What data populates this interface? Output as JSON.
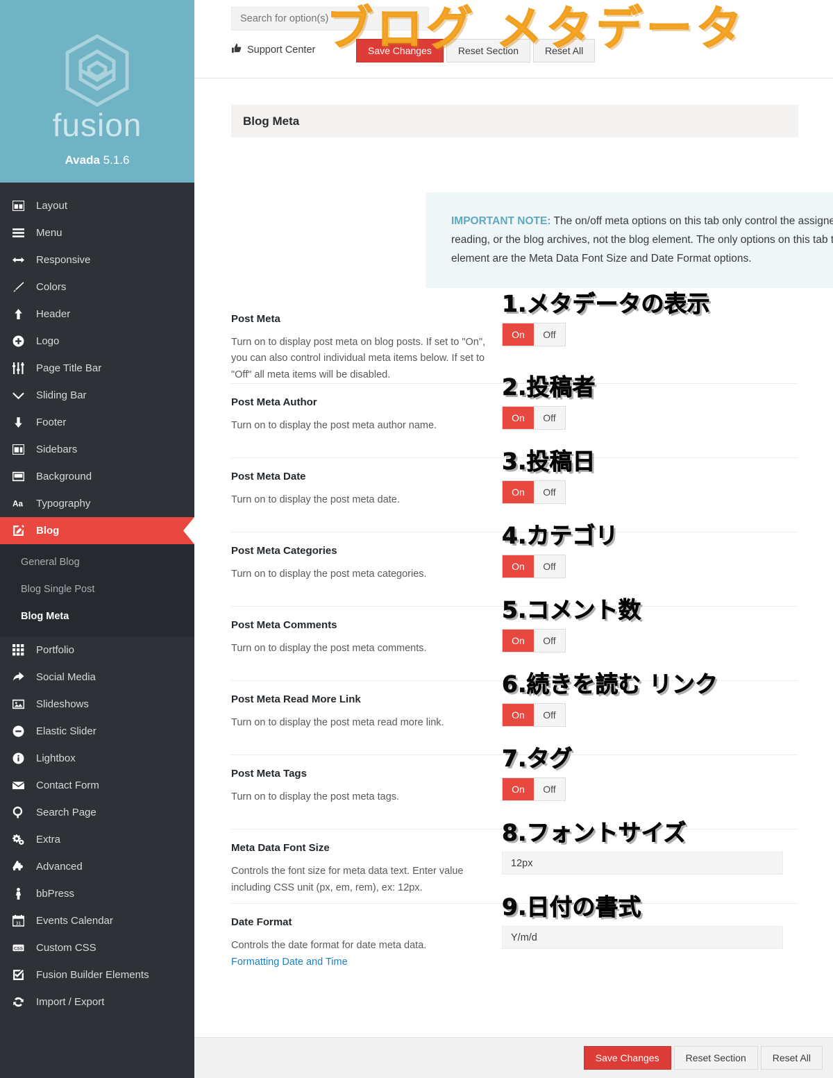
{
  "brand": {
    "logo_icon": "fusion-hex-logo-icon",
    "wordmark": "fusion",
    "product": "Avada",
    "version": "5.1.6"
  },
  "colors": {
    "brand_teal": "#6fb3c4",
    "sidebar_dark": "#2e3237",
    "submenu_dark": "#26292d",
    "accent_red": "#e8483f",
    "primary_button_red": "#dd3d36",
    "note_bg": "#eef6f8",
    "note_label": "#5fa8bd",
    "link_blue": "#1e7fbd",
    "annotation_orange": "#f5a52b"
  },
  "sidebar": {
    "items": [
      {
        "label": "Layout",
        "icon": "layout-icon"
      },
      {
        "label": "Menu",
        "icon": "menu-bars-icon"
      },
      {
        "label": "Responsive",
        "icon": "arrows-horizontal-icon"
      },
      {
        "label": "Colors",
        "icon": "paintbrush-icon"
      },
      {
        "label": "Header",
        "icon": "arrow-up-icon"
      },
      {
        "label": "Logo",
        "icon": "plus-circle-icon"
      },
      {
        "label": "Page Title Bar",
        "icon": "sliders-icon"
      },
      {
        "label": "Sliding Bar",
        "icon": "chevron-down-icon"
      },
      {
        "label": "Footer",
        "icon": "arrow-down-icon"
      },
      {
        "label": "Sidebars",
        "icon": "sidebars-icon"
      },
      {
        "label": "Background",
        "icon": "background-icon"
      },
      {
        "label": "Typography",
        "icon": "aa-text-icon"
      },
      {
        "label": "Blog",
        "icon": "pencil-square-icon",
        "active": true
      },
      {
        "label": "Portfolio",
        "icon": "grid-dots-icon"
      },
      {
        "label": "Social Media",
        "icon": "share-arrow-icon"
      },
      {
        "label": "Slideshows",
        "icon": "image-icon"
      },
      {
        "label": "Elastic Slider",
        "icon": "minus-circle-icon"
      },
      {
        "label": "Lightbox",
        "icon": "info-circle-icon"
      },
      {
        "label": "Contact Form",
        "icon": "envelope-icon"
      },
      {
        "label": "Search Page",
        "icon": "search-icon"
      },
      {
        "label": "Extra",
        "icon": "gears-icon"
      },
      {
        "label": "Advanced",
        "icon": "puzzle-piece-icon"
      },
      {
        "label": "bbPress",
        "icon": "person-icon"
      },
      {
        "label": "Events Calendar",
        "icon": "calendar-icon"
      },
      {
        "label": "Custom CSS",
        "icon": "css-badge-icon"
      },
      {
        "label": "Fusion Builder Elements",
        "icon": "check-square-icon"
      },
      {
        "label": "Import / Export",
        "icon": "sync-refresh-icon"
      }
    ],
    "submenu": [
      {
        "label": "General Blog"
      },
      {
        "label": "Blog Single Post"
      },
      {
        "label": "Blog Meta",
        "current": true
      }
    ]
  },
  "topbar": {
    "search_placeholder": "Search for option(s)",
    "search_value": "",
    "support_label": "Support Center",
    "support_icon": "thumbs-up-icon",
    "save_label": "Save Changes",
    "reset_section_label": "Reset Section",
    "reset_all_label": "Reset All"
  },
  "section": {
    "title": "Blog Meta",
    "annotation": "ブログ メタデータ"
  },
  "note": {
    "label": "IMPORTANT NOTE:",
    "body": " The on/off meta options on this tab only control the assigned blog page in settings > reading, or the blog archives, not the blog element. The only options on this tab that work with the blog element are the Meta Data Font Size and Date Format options."
  },
  "toggle_labels": {
    "on": "On",
    "off": "Off"
  },
  "options": [
    {
      "title": "Post Meta",
      "desc": "Turn on to display post meta on blog posts. If set to \"On\", you can also control individual meta items below. If set to \"Off\" all meta items will be disabled.",
      "control": "toggle",
      "value": "On",
      "annotation": "1.メタデータの表示"
    },
    {
      "title": "Post Meta Author",
      "desc": "Turn on to display the post meta author name.",
      "control": "toggle",
      "value": "On",
      "annotation": "2.投稿者"
    },
    {
      "title": "Post Meta Date",
      "desc": "Turn on to display the post meta date.",
      "control": "toggle",
      "value": "On",
      "annotation": "3.投稿日"
    },
    {
      "title": "Post Meta Categories",
      "desc": "Turn on to display the post meta categories.",
      "control": "toggle",
      "value": "On",
      "annotation": "4.カテゴリ"
    },
    {
      "title": "Post Meta Comments",
      "desc": "Turn on to display the post meta comments.",
      "control": "toggle",
      "value": "On",
      "annotation": "5.コメント数"
    },
    {
      "title": "Post Meta Read More Link",
      "desc": "Turn on to display the post meta read more link.",
      "control": "toggle",
      "value": "On",
      "annotation": "6.続きを読む リンク"
    },
    {
      "title": "Post Meta Tags",
      "desc": "Turn on to display the post meta tags.",
      "control": "toggle",
      "value": "On",
      "annotation": "7.タグ"
    },
    {
      "title": "Meta Data Font Size",
      "desc": "Controls the font size for meta data text. Enter value including CSS unit (px, em, rem), ex: 12px.",
      "control": "text",
      "value": "12px",
      "annotation": "8.フォントサイズ"
    },
    {
      "title": "Date Format",
      "desc": "Controls the date format for date meta data.",
      "link": "Formatting Date and Time",
      "control": "text",
      "value": "Y/m/d",
      "annotation": "9.日付の書式"
    }
  ],
  "footbar": {
    "save_label": "Save Changes",
    "reset_section_label": "Reset Section",
    "reset_all_label": "Reset All"
  }
}
